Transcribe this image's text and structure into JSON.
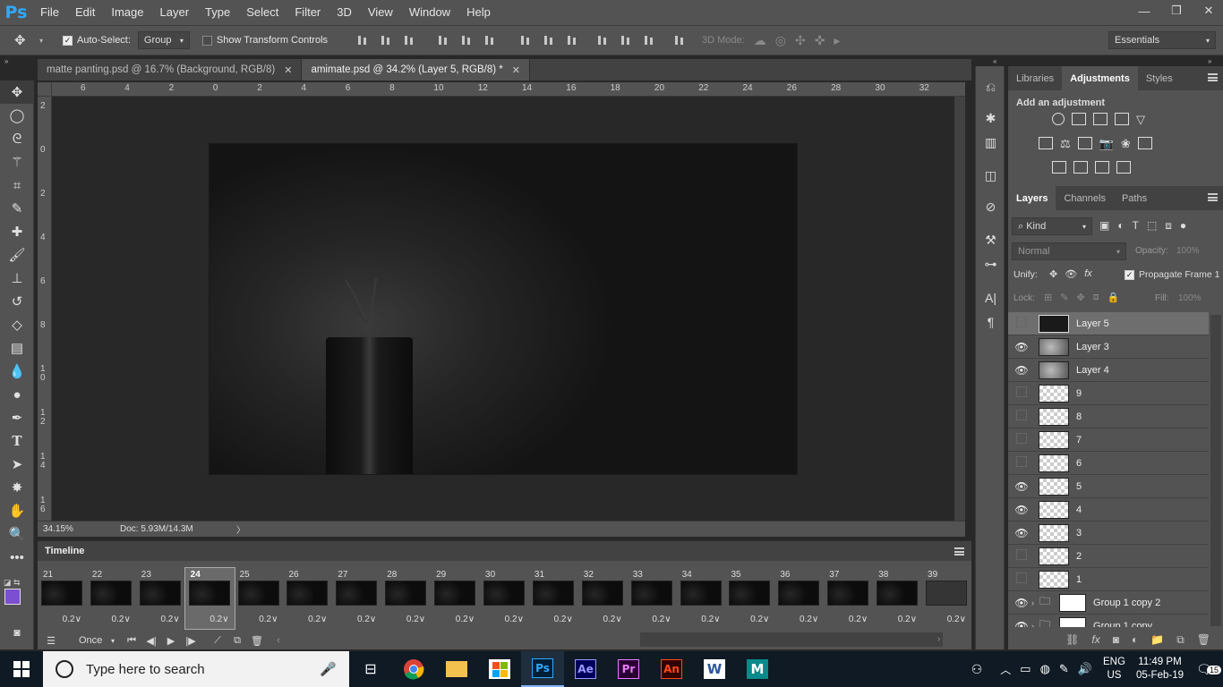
{
  "app": {
    "logo": "Ps"
  },
  "menu": [
    "File",
    "Edit",
    "Image",
    "Layer",
    "Type",
    "Select",
    "Filter",
    "3D",
    "View",
    "Window",
    "Help"
  ],
  "window_controls": {
    "minimize": "—",
    "restore": "❐",
    "close": "✕"
  },
  "options": {
    "auto_select_label": "Auto-Select:",
    "auto_select_value": "Group",
    "show_transform_label": "Show Transform Controls",
    "mode_3d_label": "3D Mode:",
    "workspace": "Essentials"
  },
  "doc_tabs": [
    {
      "label": "matte panting.psd @ 16.7% (Background, RGB/8)",
      "active": false
    },
    {
      "label": "amimate.psd @ 34.2% (Layer 5, RGB/8) *",
      "active": true
    }
  ],
  "ruler_top": [
    "6",
    "4",
    "2",
    "0",
    "2",
    "4",
    "6",
    "8",
    "10",
    "12",
    "14",
    "16",
    "18",
    "20",
    "22",
    "24",
    "26",
    "28",
    "30",
    "32"
  ],
  "ruler_left": [
    "2",
    "0",
    "2",
    "4",
    "6",
    "8",
    "1 0",
    "1 2",
    "1 4",
    "1 6"
  ],
  "status": {
    "zoom": "34.15%",
    "doc": "Doc: 5.93M/14.3M"
  },
  "timeline": {
    "title": "Timeline",
    "frames": [
      {
        "num": "21",
        "delay": "0.2"
      },
      {
        "num": "22",
        "delay": "0.2"
      },
      {
        "num": "23",
        "delay": "0.2"
      },
      {
        "num": "24",
        "delay": "0.2"
      },
      {
        "num": "25",
        "delay": "0.2"
      },
      {
        "num": "26",
        "delay": "0.2"
      },
      {
        "num": "27",
        "delay": "0.2"
      },
      {
        "num": "28",
        "delay": "0.2"
      },
      {
        "num": "29",
        "delay": "0.2"
      },
      {
        "num": "30",
        "delay": "0.2"
      },
      {
        "num": "31",
        "delay": "0.2"
      },
      {
        "num": "32",
        "delay": "0.2"
      },
      {
        "num": "33",
        "delay": "0.2"
      },
      {
        "num": "34",
        "delay": "0.2"
      },
      {
        "num": "35",
        "delay": "0.2"
      },
      {
        "num": "36",
        "delay": "0.2"
      },
      {
        "num": "37",
        "delay": "0.2"
      },
      {
        "num": "38",
        "delay": "0.2"
      },
      {
        "num": "39",
        "delay": "0.2"
      }
    ],
    "selected_frame": "24",
    "loop": "Once"
  },
  "right_tabs_top": [
    "Libraries",
    "Adjustments",
    "Styles"
  ],
  "adjustments_title": "Add an adjustment",
  "layers_tabs": [
    "Layers",
    "Channels",
    "Paths"
  ],
  "layers_panel": {
    "filter": "Kind",
    "blend": "Normal",
    "opacity_label": "Opacity:",
    "opacity_value": "100%",
    "unify_label": "Unify:",
    "propagate_label": "Propagate Frame 1",
    "lock_label": "Lock:",
    "fill_label": "Fill:",
    "fill_value": "100%"
  },
  "layers": [
    {
      "name": "Layer 5",
      "visible": false,
      "selected": true,
      "thumb": "dark"
    },
    {
      "name": "Layer 3",
      "visible": true,
      "selected": false,
      "thumb": "cloud"
    },
    {
      "name": "Layer 4",
      "visible": true,
      "selected": false,
      "thumb": "cloud"
    },
    {
      "name": "9",
      "visible": false,
      "selected": false,
      "thumb": "transparent"
    },
    {
      "name": "8",
      "visible": false,
      "selected": false,
      "thumb": "transparent"
    },
    {
      "name": "7",
      "visible": false,
      "selected": false,
      "thumb": "transparent"
    },
    {
      "name": "6",
      "visible": false,
      "selected": false,
      "thumb": "transparent"
    },
    {
      "name": "5",
      "visible": true,
      "selected": false,
      "thumb": "transparent"
    },
    {
      "name": "4",
      "visible": true,
      "selected": false,
      "thumb": "transparent"
    },
    {
      "name": "3",
      "visible": true,
      "selected": false,
      "thumb": "transparent"
    },
    {
      "name": "2",
      "visible": false,
      "selected": false,
      "thumb": "transparent"
    },
    {
      "name": "1",
      "visible": false,
      "selected": false,
      "thumb": "transparent"
    },
    {
      "name": "Group 1 copy 2",
      "visible": true,
      "selected": false,
      "thumb": "group"
    },
    {
      "name": "Group 1 copy",
      "visible": true,
      "selected": false,
      "thumb": "group"
    }
  ],
  "taskbar": {
    "search_placeholder": "Type here to search",
    "apps": [
      "chrome",
      "explorer",
      "store",
      "Ps",
      "Ae",
      "Pr",
      "An",
      "W",
      "M"
    ],
    "lang_top": "ENG",
    "lang_bottom": "US",
    "time": "11:49 PM",
    "date": "05-Feb-19",
    "notifications": "15"
  },
  "colors": {
    "accent_ps": "#31a8ff",
    "fg_swatch": "#7b4fd0",
    "bg_swatch": "#000000"
  }
}
